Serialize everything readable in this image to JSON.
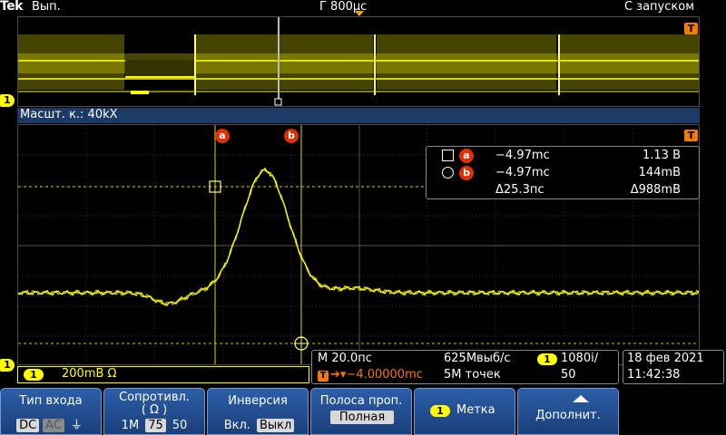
{
  "topbar": {
    "logo": "Tek",
    "run_state": "Вып.",
    "timebase": "Г 800μс",
    "trigger_mode": "С запуском"
  },
  "overview": {
    "zoom_box_label": "[]"
  },
  "zoom": {
    "label": "Масшт. к.: 40kX"
  },
  "channel_marker": "1",
  "trigger_marker": "T",
  "cursors": {
    "a_label": "a",
    "b_label": "b"
  },
  "readout": {
    "a": {
      "label": "a",
      "time": "−4.97mc",
      "value": "1.13 В"
    },
    "b": {
      "label": "b",
      "time": "−4.97mc",
      "value": "144mВ"
    },
    "delta": {
      "time": "Δ25.3пс",
      "value": "Δ988mВ"
    }
  },
  "channel_status": {
    "badge": "1",
    "text": "200mВ Ω"
  },
  "horizontal": {
    "scale": "M 20.0пс",
    "position": "−4.00000mc",
    "sample_rate": "625Mвыб/с",
    "record_length": "5M точек",
    "trigger_badge": "1",
    "trigger_level_line1": "1080i/",
    "trigger_level_line2": "50"
  },
  "datetime": {
    "date": "18 фев 2021",
    "time": "11:42:38"
  },
  "menu": {
    "input_type": {
      "label": "Тип входа",
      "options": [
        "DC",
        "AC",
        "⏚"
      ]
    },
    "impedance": {
      "label": "Сопротивл.",
      "label2": "( Ω )",
      "options": [
        "1M",
        "75",
        "50"
      ]
    },
    "invert": {
      "label": "Инверсия",
      "options": [
        "Вкл.",
        "Выкл"
      ]
    },
    "bandwidth": {
      "label": "Полоса проп.",
      "value": "Полная"
    },
    "label_key": {
      "badge": "1",
      "label": "Метка"
    },
    "more": {
      "label": "Дополнит."
    }
  },
  "colors": {
    "trace": "#ffff00",
    "trigger": "#f57a00",
    "cursor": "#e03000",
    "menu": "#2c5ea8"
  }
}
